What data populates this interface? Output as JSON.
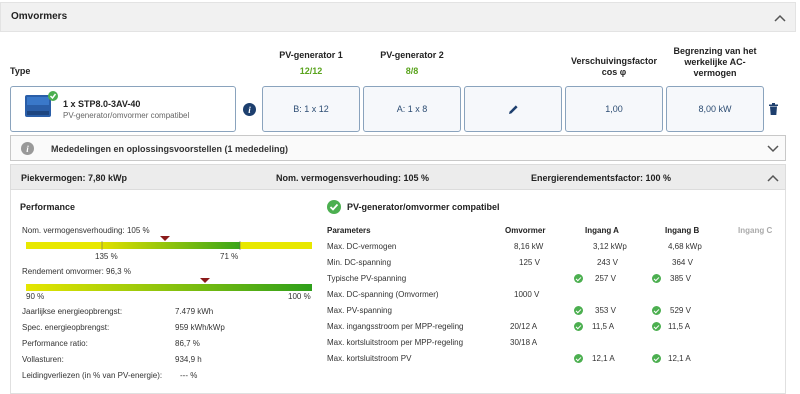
{
  "header": {
    "title": "Omvormers"
  },
  "columns": {
    "type": "Type",
    "pv1_title": "PV-generator 1",
    "pv1_count": "12/12",
    "pv2_title": "PV-generator 2",
    "pv2_count": "8/8",
    "cosphi_l1": "Verschuivingsfactor",
    "cosphi_l2": "cos φ",
    "limit_l1": "Begrenzing van het",
    "limit_l2": "werkelijke AC-",
    "limit_l3": "vermogen"
  },
  "inverter": {
    "name": "1 x STP8.0-3AV-40",
    "compat": "PV-generator/omvormer compatibel",
    "pv1_value": "B: 1 x 12",
    "pv2_value": "A: 1 x 8",
    "cosphi_value": "1,00",
    "limit_value": "8,00 kW"
  },
  "notice": {
    "label": "Mededelingen en oplossingsvoorstellen (1 mededeling)"
  },
  "summary": {
    "peak": "Piekvermogen: 7,80 kWp",
    "ratio": "Nom. vermogensverhouding: 105 %",
    "efficiency": "Energierendementsfactor: 100 %"
  },
  "performance": {
    "title": "Performance",
    "ratio_label": "Nom. vermogensverhouding: 105 %",
    "ratio_left": "135 %",
    "ratio_right": "71 %",
    "eff_label": "Rendement omvormer: 96,3 %",
    "eff_left": "90 %",
    "eff_right": "100 %",
    "rows": [
      {
        "label": "Jaarlijkse energieopbrengst:",
        "value": "7.479 kWh"
      },
      {
        "label": "Spec. energieopbrengst:",
        "value": "959 kWh/kWp"
      },
      {
        "label": "Performance ratio:",
        "value": "86,7 %"
      },
      {
        "label": "Vollasturen:",
        "value": "934,9 h"
      },
      {
        "label": "Leidingverliezen (in % van PV-energie):",
        "value": "--- %"
      }
    ]
  },
  "compat": {
    "title": "PV-generator/omvormer compatibel",
    "headers": [
      "Parameters",
      "Omvormer",
      "Ingang A",
      "Ingang B",
      "Ingang C"
    ],
    "rows": [
      {
        "param": "Max. DC-vermogen",
        "inv": "8,16 kW",
        "a": "3,12 kWp",
        "b": "4,68 kWp"
      },
      {
        "param": "Min. DC-spanning",
        "inv": "125 V",
        "a": "243 V",
        "b": "364 V"
      },
      {
        "param": "Typische PV-spanning",
        "inv": "",
        "a": "257 V",
        "b": "385 V"
      },
      {
        "param": "Max. DC-spanning (Omvormer)",
        "inv": "1000 V",
        "a": "",
        "b": ""
      },
      {
        "param": "Max. PV-spanning",
        "inv": "",
        "a": "353 V",
        "b": "529 V"
      },
      {
        "param": "Max. ingangsstroom per MPP-regeling",
        "inv": "20/12 A",
        "a": "11,5 A",
        "b": "11,5 A"
      },
      {
        "param": "Max. kortsluitstroom per MPP-regeling",
        "inv": "30/18 A",
        "a": "",
        "b": ""
      },
      {
        "param": "Max. kortsluitstroom PV",
        "inv": "",
        "a": "12,1 A",
        "b": "12,1 A"
      }
    ]
  }
}
